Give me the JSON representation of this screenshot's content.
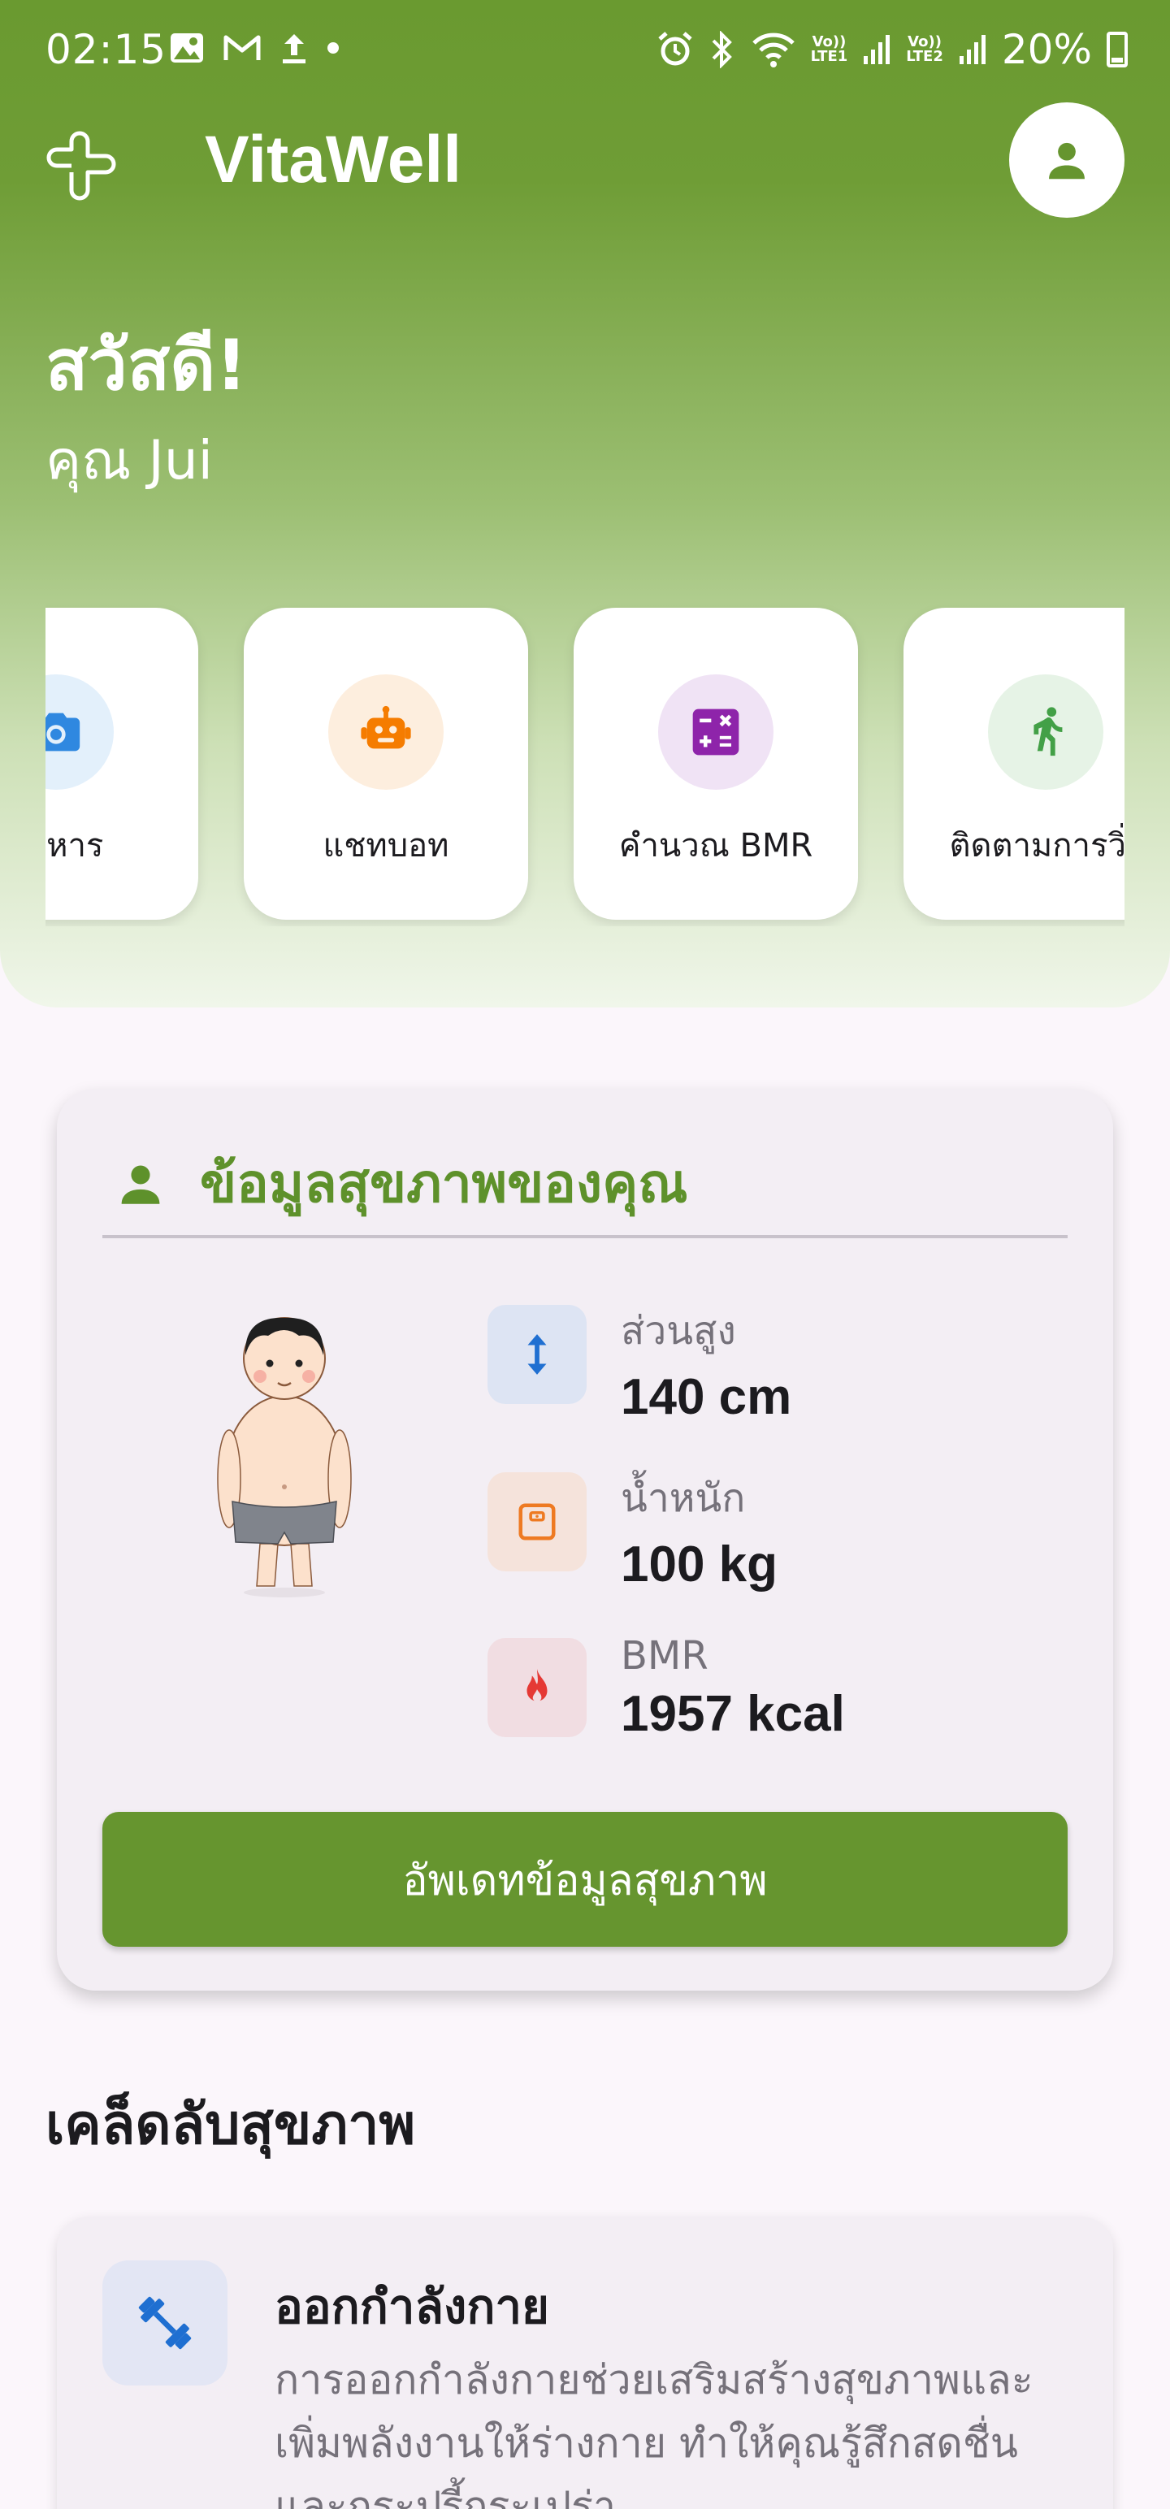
{
  "status_bar": {
    "time": "02:15",
    "left_icons": [
      "image-icon",
      "gmail-icon",
      "upload-icon",
      "dot-icon"
    ],
    "right_icons": [
      "alarm-icon",
      "bluetooth-icon",
      "wifi-icon",
      "signal-sim1-icon",
      "signal-sim2-icon"
    ],
    "sim1_tag_top": "Vo))",
    "sim1_tag_bottom": "LTE1",
    "sim2_tag_top": "Vo))",
    "sim2_tag_bottom": "LTE2",
    "battery": "20%"
  },
  "app_bar": {
    "title": "VitaWell",
    "logo_icon": "plus-leaf-icon",
    "profile_icon": "person-icon"
  },
  "greeting": {
    "hello": "สวัสดี!",
    "name": "คุณ Jui"
  },
  "quick_actions": [
    {
      "label": "อาหาร",
      "icon": "camera-icon",
      "bg": "#e3f0fb",
      "fg": "#2f88e0"
    },
    {
      "label": "แชทบอท",
      "icon": "robot-icon",
      "bg": "#fdeede",
      "fg": "#f57c00"
    },
    {
      "label": "คำนวณ BMR",
      "icon": "calculator-icon",
      "bg": "#f0e3f5",
      "fg": "#8e24aa"
    },
    {
      "label": "ติดตามการวิ่ง",
      "icon": "running-icon",
      "bg": "#e6f3e6",
      "fg": "#43a047"
    }
  ],
  "health": {
    "title": "ข้อมูลสุขภาพของคุณ",
    "height_label": "ส่วนสูง",
    "height_value": "140 cm",
    "weight_label": "น้ำหนัก",
    "weight_value": "100 kg",
    "bmr_label": "BMR",
    "bmr_value": "1957 kcal",
    "update_button": "อัพเดทข้อมูลสุขภาพ",
    "colors": {
      "accent": "#5e912b",
      "button": "#66952f"
    }
  },
  "tips": {
    "section_title": "เคล็ดลับสุขภาพ",
    "items": [
      {
        "title": "ออกกำลังกาย",
        "icon": "dumbbell-icon",
        "body": "การออกกำลังกายช่วยเสริมสร้างสุขภาพและเพิ่มพลังงานให้ร่างกาย ทำให้คุณรู้สึกสดชื่นและกระปรี้กระเปร่า"
      }
    ]
  }
}
